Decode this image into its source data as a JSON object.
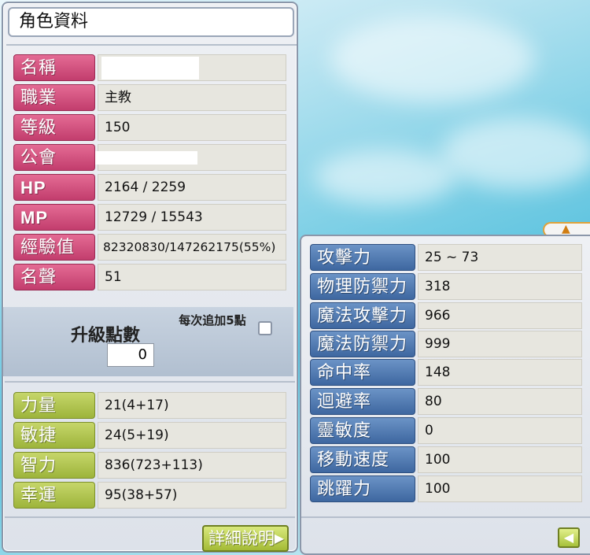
{
  "window_title": "角色資料",
  "basic_info": [
    {
      "label": "名稱",
      "value": ""
    },
    {
      "label": "職業",
      "value": "主教"
    },
    {
      "label": "等級",
      "value": "150"
    },
    {
      "label": "公會",
      "value": ""
    },
    {
      "label": "HP",
      "value": "2164 / 2259"
    },
    {
      "label": "MP",
      "value": "12729 / 15543"
    },
    {
      "label": "經驗值",
      "value": "82320830/147262175(55%)"
    },
    {
      "label": "名聲",
      "value": "51"
    }
  ],
  "ability_points": {
    "label": "升級點數",
    "value": "0",
    "add5_label": "每次追加5點",
    "add5_checked": false
  },
  "stats": [
    {
      "label": "力量",
      "value": "21(4+17)"
    },
    {
      "label": "敏捷",
      "value": "24(5+19)"
    },
    {
      "label": "智力",
      "value": "836(723+113)"
    },
    {
      "label": "幸運",
      "value": "95(38+57)"
    }
  ],
  "detail_button": {
    "label": "詳細說明",
    "icon": "chevron-right-icon"
  },
  "detail_stats": [
    {
      "label": "攻擊力",
      "value": "25 ~ 73"
    },
    {
      "label": "物理防禦力",
      "value": "318"
    },
    {
      "label": "魔法攻擊力",
      "value": "966"
    },
    {
      "label": "魔法防禦力",
      "value": "999"
    },
    {
      "label": "命中率",
      "value": "148"
    },
    {
      "label": "迴避率",
      "value": "80"
    },
    {
      "label": "靈敏度",
      "value": "0"
    },
    {
      "label": "移動速度",
      "value": "100"
    },
    {
      "label": "跳躍力",
      "value": "100"
    }
  ],
  "back_button": {
    "icon": "arrow-left-icon"
  },
  "colors": {
    "label_pink": "#c23d6d",
    "label_green": "#9db43b",
    "label_blue": "#3e67a0",
    "value_bg": "#e7e6df"
  }
}
